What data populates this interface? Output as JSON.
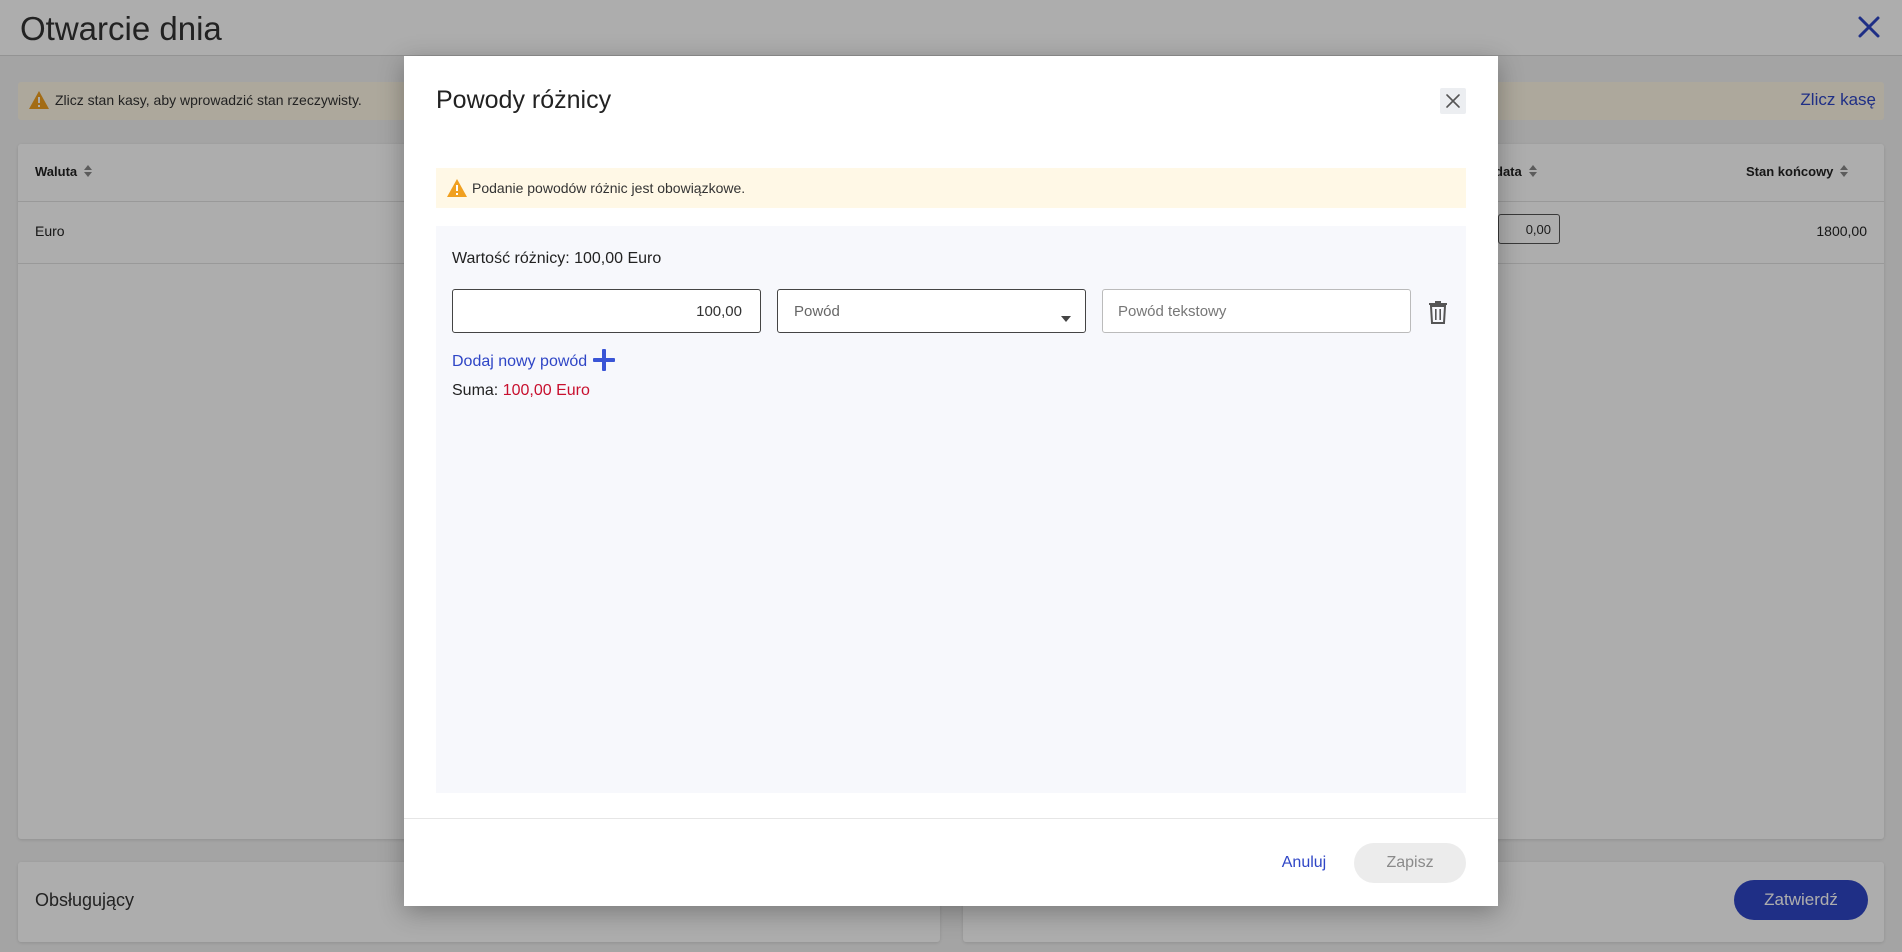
{
  "page": {
    "title": "Otwarcie dnia",
    "alert_text": "Zlicz stan kasy, aby wprowadzić stan rzeczywisty.",
    "alert_link": "Zlicz kasę",
    "table": {
      "headers": {
        "currency": "Waluta",
        "partial": "data",
        "final_balance": "Stan końcowy"
      },
      "row": {
        "currency": "Euro",
        "input_value": "0,00",
        "final_balance": "1800,00"
      }
    },
    "operators_title": "Obsługujący",
    "confirm_label": "Zatwierdź"
  },
  "modal": {
    "title": "Powody różnicy",
    "alert_text": "Podanie powodów różnic jest obowiązkowe.",
    "difference_label": "Wartość różnicy: 100,00 Euro",
    "amount_value": "100,00",
    "reason_select_placeholder": "Powód",
    "text_reason_placeholder": "Powód tekstowy",
    "add_reason_label": "Dodaj nowy powód",
    "sum_label": "Suma:",
    "sum_value": "100,00 Euro",
    "cancel_label": "Anuluj",
    "save_label": "Zapisz"
  },
  "colors": {
    "accent": "#2f46c6",
    "warning": "#f0a020",
    "error": "#c8102e"
  },
  "icons": [
    "warning-icon",
    "sort-icon",
    "close-icon",
    "chevron-down-icon",
    "trash-icon",
    "plus-icon"
  ]
}
